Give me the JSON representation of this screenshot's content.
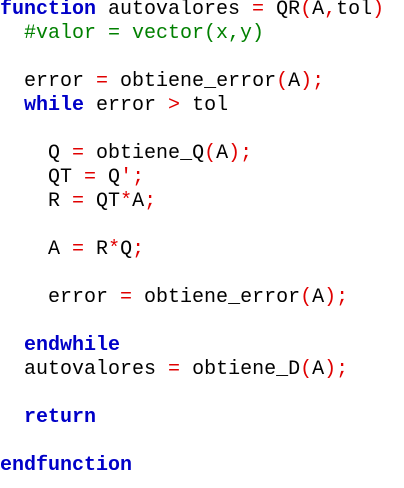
{
  "editor": {
    "lines": [
      {
        "indent": "",
        "parts": [
          {
            "text": "function",
            "cls": "kw"
          },
          {
            "text": " autovalores ",
            "cls": "tx"
          },
          {
            "text": "=",
            "cls": "op"
          },
          {
            "text": " QR",
            "cls": "tx"
          },
          {
            "text": "(",
            "cls": "op"
          },
          {
            "text": "A",
            "cls": "tx"
          },
          {
            "text": ",",
            "cls": "op"
          },
          {
            "text": "tol",
            "cls": "tx"
          },
          {
            "text": ")",
            "cls": "op"
          }
        ]
      },
      {
        "indent": "  ",
        "parts": [
          {
            "text": "#valor = vector(x,y)",
            "cls": "cm"
          }
        ]
      },
      {
        "indent": "",
        "parts": []
      },
      {
        "indent": "  ",
        "parts": [
          {
            "text": "error ",
            "cls": "tx"
          },
          {
            "text": "=",
            "cls": "op"
          },
          {
            "text": " obtiene_error",
            "cls": "tx"
          },
          {
            "text": "(",
            "cls": "op"
          },
          {
            "text": "A",
            "cls": "tx"
          },
          {
            "text": ");",
            "cls": "op"
          }
        ]
      },
      {
        "indent": "  ",
        "parts": [
          {
            "text": "while",
            "cls": "kw"
          },
          {
            "text": " error ",
            "cls": "tx"
          },
          {
            "text": ">",
            "cls": "op"
          },
          {
            "text": " tol",
            "cls": "tx"
          }
        ]
      },
      {
        "indent": "",
        "parts": []
      },
      {
        "indent": "    ",
        "parts": [
          {
            "text": "Q ",
            "cls": "tx"
          },
          {
            "text": "=",
            "cls": "op"
          },
          {
            "text": " obtiene_Q",
            "cls": "tx"
          },
          {
            "text": "(",
            "cls": "op"
          },
          {
            "text": "A",
            "cls": "tx"
          },
          {
            "text": ");",
            "cls": "op"
          }
        ]
      },
      {
        "indent": "    ",
        "parts": [
          {
            "text": "QT ",
            "cls": "tx"
          },
          {
            "text": "=",
            "cls": "op"
          },
          {
            "text": " Q",
            "cls": "tx"
          },
          {
            "text": "';",
            "cls": "op"
          }
        ]
      },
      {
        "indent": "    ",
        "parts": [
          {
            "text": "R ",
            "cls": "tx"
          },
          {
            "text": "=",
            "cls": "op"
          },
          {
            "text": " QT",
            "cls": "tx"
          },
          {
            "text": "*",
            "cls": "op"
          },
          {
            "text": "A",
            "cls": "tx"
          },
          {
            "text": ";",
            "cls": "op"
          }
        ]
      },
      {
        "indent": "",
        "parts": []
      },
      {
        "indent": "    ",
        "parts": [
          {
            "text": "A ",
            "cls": "tx"
          },
          {
            "text": "=",
            "cls": "op"
          },
          {
            "text": " R",
            "cls": "tx"
          },
          {
            "text": "*",
            "cls": "op"
          },
          {
            "text": "Q",
            "cls": "tx"
          },
          {
            "text": ";",
            "cls": "op"
          }
        ]
      },
      {
        "indent": "",
        "parts": []
      },
      {
        "indent": "    ",
        "parts": [
          {
            "text": "error ",
            "cls": "tx"
          },
          {
            "text": "=",
            "cls": "op"
          },
          {
            "text": " obtiene_error",
            "cls": "tx"
          },
          {
            "text": "(",
            "cls": "op"
          },
          {
            "text": "A",
            "cls": "tx"
          },
          {
            "text": ");",
            "cls": "op"
          }
        ]
      },
      {
        "indent": "",
        "parts": []
      },
      {
        "indent": "  ",
        "parts": [
          {
            "text": "endwhile",
            "cls": "kw"
          }
        ]
      },
      {
        "indent": "  ",
        "parts": [
          {
            "text": "autovalores ",
            "cls": "tx"
          },
          {
            "text": "=",
            "cls": "op"
          },
          {
            "text": " obtiene_D",
            "cls": "tx"
          },
          {
            "text": "(",
            "cls": "op"
          },
          {
            "text": "A",
            "cls": "tx"
          },
          {
            "text": ");",
            "cls": "op"
          }
        ]
      },
      {
        "indent": "",
        "parts": []
      },
      {
        "indent": "  ",
        "parts": [
          {
            "text": "return",
            "cls": "kw"
          }
        ]
      },
      {
        "indent": "",
        "parts": []
      },
      {
        "indent": "",
        "parts": [
          {
            "text": "endfunction",
            "cls": "kw"
          }
        ]
      }
    ]
  }
}
